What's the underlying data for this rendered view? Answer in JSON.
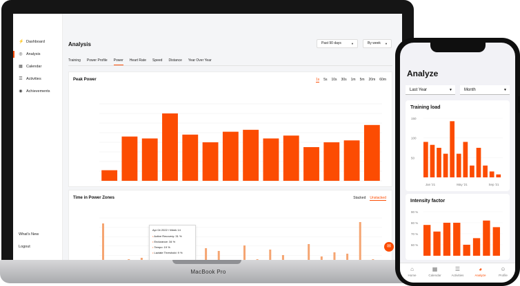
{
  "laptop": {
    "brand_label": "MacBook Pro"
  },
  "sidebar": {
    "items": [
      {
        "label": "Dashboard",
        "icon": "bolt-icon"
      },
      {
        "label": "Analysis",
        "icon": "target-icon",
        "active": true
      },
      {
        "label": "Calendar",
        "icon": "calendar-icon"
      },
      {
        "label": "Activities",
        "icon": "list-icon"
      },
      {
        "label": "Achievements",
        "icon": "medal-icon"
      }
    ],
    "footer": [
      "What's New",
      "Logout"
    ]
  },
  "header": {
    "title": "Analysis",
    "period_select": "Past 90 days",
    "group_select": "By week"
  },
  "tabs": [
    "Training",
    "Power Profile",
    "Power",
    "Heart Rate",
    "Speed",
    "Distance",
    "Year Over Year"
  ],
  "active_tab": "Power",
  "peak_power": {
    "title": "Peak Power",
    "ranges": [
      "1s",
      "5s",
      "10s",
      "30s",
      "1m",
      "5m",
      "20m",
      "60m"
    ],
    "active_range": "1s"
  },
  "zones": {
    "title": "Time in Power Zones",
    "options": [
      "Stacked",
      "Unstacked"
    ],
    "active_option": "Unstacked",
    "tooltip": {
      "title": "Apr 04 2022 / Week 14",
      "rows": [
        "Active Recovery: 31 %",
        "Endurance: 34 %",
        "Tempo: 19 %",
        "Lactate Threshold: 9 %"
      ]
    }
  },
  "chart_data": [
    {
      "type": "bar",
      "title": "Peak Power",
      "values": [
        310,
        660,
        640,
        900,
        680,
        600,
        710,
        730,
        640,
        670,
        550,
        600,
        620,
        780
      ],
      "ylim": [
        200,
        1000
      ],
      "grid": true,
      "color": "#fc4c02"
    },
    {
      "type": "bar",
      "title": "Training load",
      "values": [
        60,
        55,
        50,
        40,
        95,
        40,
        60,
        20,
        50,
        20,
        10,
        5
      ],
      "x_ticks": [
        "Jan '21",
        "May '21",
        "Sep '21"
      ],
      "y_ticks": [
        "150",
        "100",
        "50"
      ],
      "color": "#fc4c02"
    },
    {
      "type": "bar",
      "title": "Intensity factor",
      "values": [
        78,
        72,
        80,
        80,
        60,
        66,
        82,
        76
      ],
      "y_ticks": [
        "90 %",
        "80 %",
        "70 %",
        "60 %"
      ],
      "color": "#fc4c02"
    }
  ],
  "phone": {
    "title": "Analyze",
    "select_period": "Last Year",
    "select_group": "Month",
    "tabbar": [
      "Home",
      "Calendar",
      "Activities",
      "Analyze",
      "Profile"
    ],
    "active_tab": "Analyze"
  },
  "colors": {
    "accent": "#fc4c02",
    "zone_bar": "#f5a572"
  }
}
